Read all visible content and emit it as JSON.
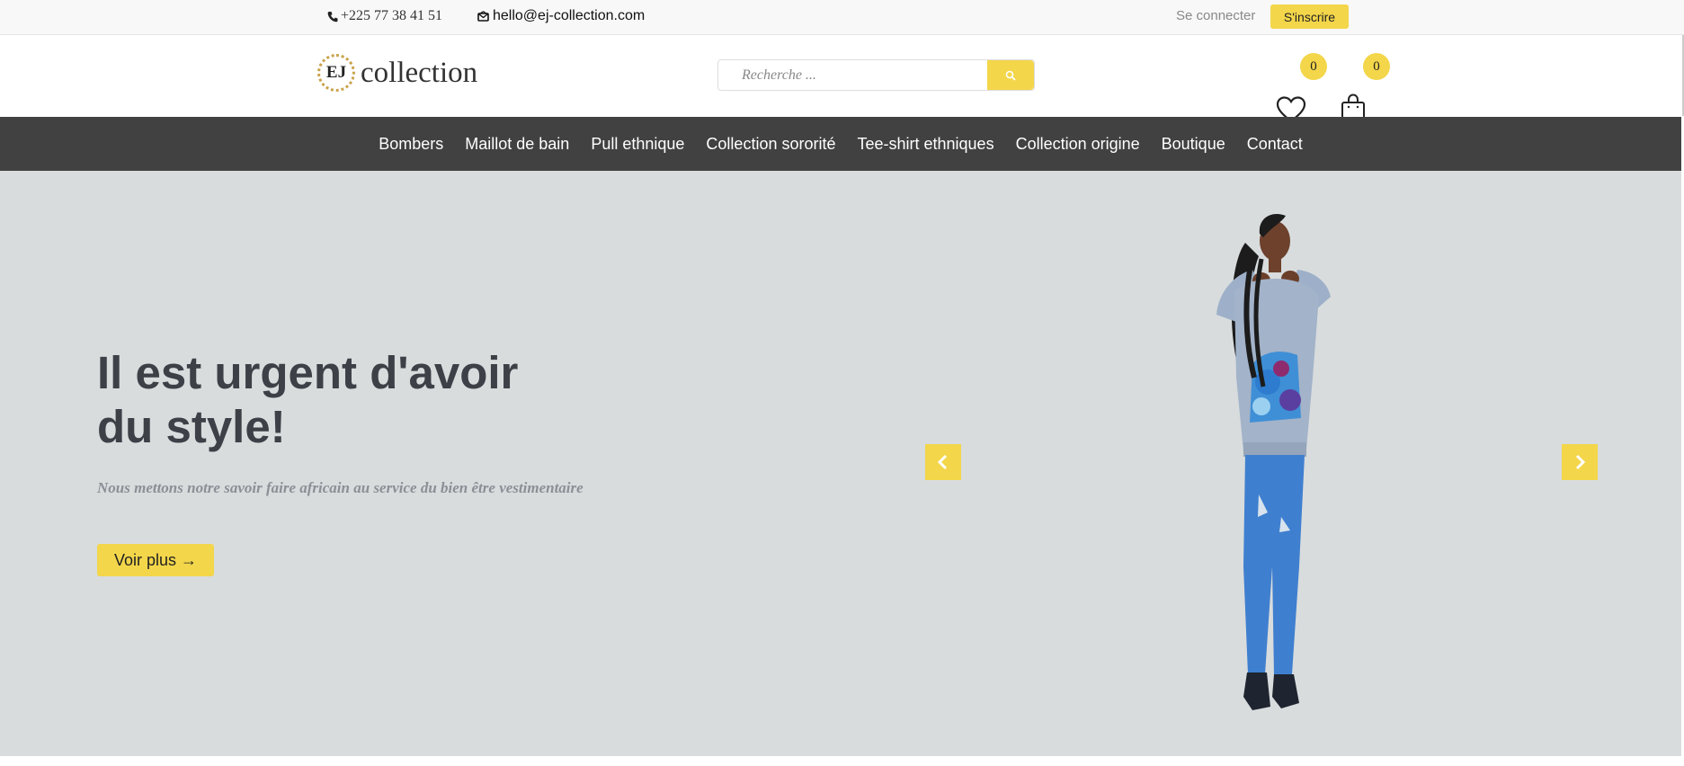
{
  "topbar": {
    "phone": "+225 77 38 41 51",
    "email": "hello@ej-collection.com",
    "login_label": "Se connecter",
    "signup_label": "S'inscrire"
  },
  "header": {
    "logo_monogram": "EJ",
    "logo_text": "collection",
    "search_placeholder": "Recherche ...",
    "wishlist_count": "0",
    "cart_count": "0"
  },
  "nav": {
    "items": [
      {
        "label": "Bombers"
      },
      {
        "label": "Maillot de bain"
      },
      {
        "label": "Pull ethnique"
      },
      {
        "label": "Collection sororité"
      },
      {
        "label": "Tee-shirt ethniques"
      },
      {
        "label": "Collection origine"
      },
      {
        "label": "Boutique"
      },
      {
        "label": "Contact"
      }
    ]
  },
  "hero": {
    "title_line1": "Il est urgent d'avoir",
    "title_line2": "du style!",
    "subtitle": "Nous mettons notre savoir faire africain au service du bien être vestimentaire",
    "cta_label": "Voir plus →"
  },
  "icons": {
    "phone": "phone-icon",
    "email": "envelope-icon",
    "search": "search-icon",
    "wishlist": "heart-icon",
    "cart": "shopping-bag-icon",
    "prev": "chevron-left-icon",
    "next": "chevron-right-icon"
  },
  "colors": {
    "accent": "#f3d64a",
    "nav_bg": "#414141",
    "hero_bg": "#d8dcdd",
    "hero_title": "#3d4047"
  }
}
